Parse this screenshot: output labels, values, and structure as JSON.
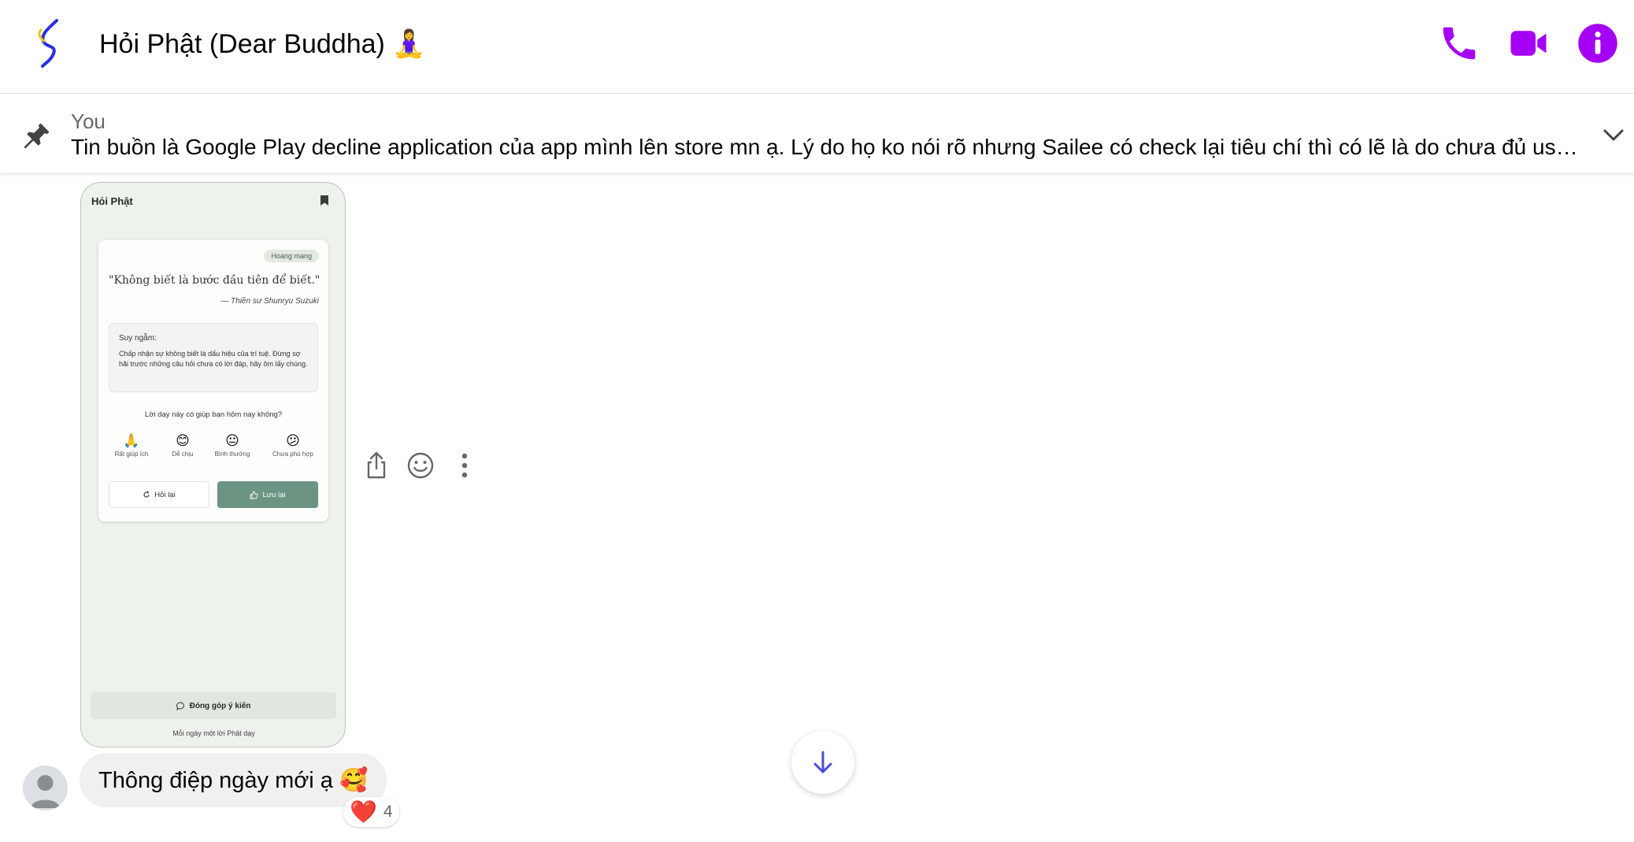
{
  "header": {
    "title": "Hỏi Phật (Dear Buddha) 🧘‍♀️",
    "accent_color": "#a400f5",
    "buttons": [
      "phone-icon",
      "video-camera-icon",
      "info-icon"
    ]
  },
  "pinned": {
    "author": "You",
    "text": "Tin buồn là Google Play decline application của app mình lên store mn ạ. Lý do họ ko nói rõ nhưng Sailee có check lại tiêu chí thì có lẽ là do chưa đủ user để được publish lên store. Có thể do mình gần tết nên đã bị nghiêm ngặt hơn."
  },
  "screenshot_image": {
    "app_title": "Hỏi Phật",
    "tag": "Hoang mang",
    "quote": "\"Không biết là bước đầu tiên để biết.\"",
    "quote_author": "— Thiền sư Shunryu Suzuki",
    "reflection_label": "Suy ngẫm:",
    "reflection_text": "Chấp nhận sự không biết là dấu hiệu của trí tuệ. Đừng sợ hãi trước những câu hỏi chưa có lời đáp, hãy ôm lấy chúng.",
    "question": "Lời dạy này có giúp bạn hôm nay không?",
    "emoji_options": [
      {
        "emoji": "🙏",
        "label": "Rất giúp ích"
      },
      {
        "emoji": "😊",
        "label": "Dễ chịu"
      },
      {
        "emoji": "😐",
        "label": "Bình thường"
      },
      {
        "emoji": "😕",
        "label": "Chưa phù hợp"
      }
    ],
    "ask_again_label": "Hỏi lại",
    "save_label": "Lưu lại",
    "feedback_label": "Đóng góp ý kiến",
    "footer": "Mỗi ngày một lời Phật dạy"
  },
  "message_actions": [
    "share-icon",
    "emoji-reaction-icon",
    "more-options-icon"
  ],
  "text_message": {
    "text": "Thông điệp ngày mới ạ 🥰",
    "reaction_emoji": "❤️",
    "reaction_count": "4"
  }
}
